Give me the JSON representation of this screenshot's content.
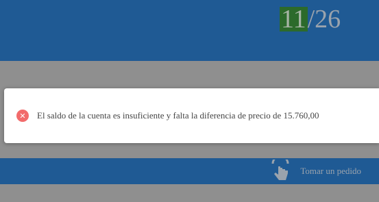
{
  "header": {
    "counter_current": "11",
    "counter_total": "/26"
  },
  "toast": {
    "icon": "error-icon",
    "message": "El saldo de la cuenta es insuficiente y falta la diferencia de precio de 15.760,00",
    "accent_color": "#f26b6b"
  },
  "bottom_bar": {
    "order_icon": "tap-hand-icon",
    "order_label": "Tomar un pedido"
  },
  "colors": {
    "primary": "#1f5a94",
    "overlay": "#8f8f8f",
    "counter_highlight": "#2c6a2b"
  }
}
